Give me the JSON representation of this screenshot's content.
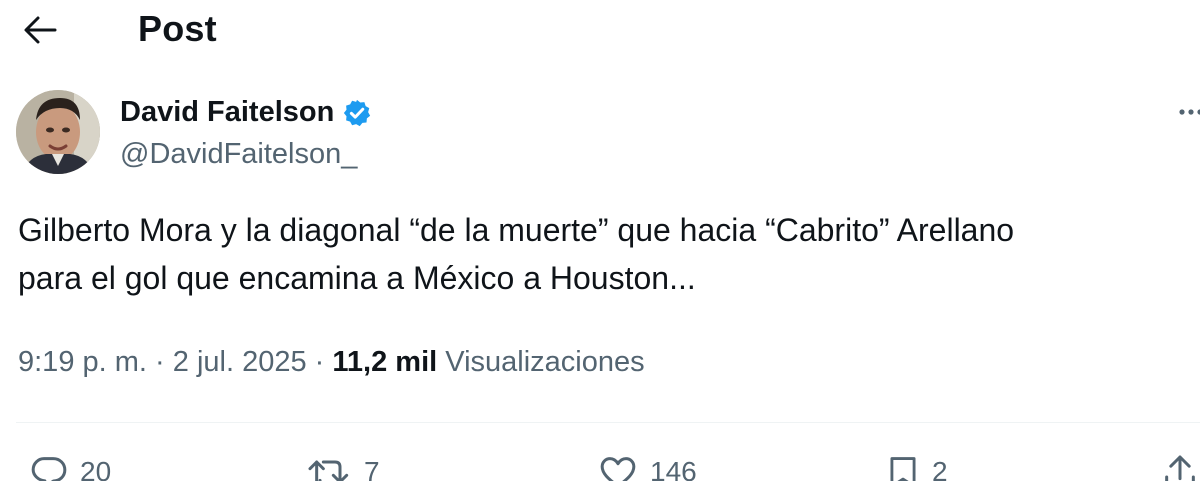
{
  "header": {
    "title": "Post"
  },
  "author": {
    "name": "David Faitelson",
    "handle": "@DavidFaitelson_",
    "verified": true
  },
  "post": {
    "lines": [
      "Gilberto Mora y la diagonal  “de la muerte” que hacia “Cabrito” Arellano",
      "para el gol que encamina a México a Houston..."
    ]
  },
  "meta": {
    "time": "9:19 p. m.",
    "separator": "·",
    "date": "2 jul. 2025",
    "views_count": "11,2 mil",
    "views_label": "Visualizaciones"
  },
  "actions": {
    "replies": "20",
    "reposts": "7",
    "likes": "146",
    "bookmarks": "2"
  },
  "colors": {
    "text": "#0f1419",
    "secondary": "#536471",
    "verified_blue": "#1d9bf0",
    "divider": "#eff3f4"
  },
  "icons": [
    "back-arrow-icon",
    "verified-badge-icon",
    "more-icon",
    "reply-icon",
    "repost-icon",
    "like-icon",
    "bookmark-icon",
    "share-icon"
  ]
}
